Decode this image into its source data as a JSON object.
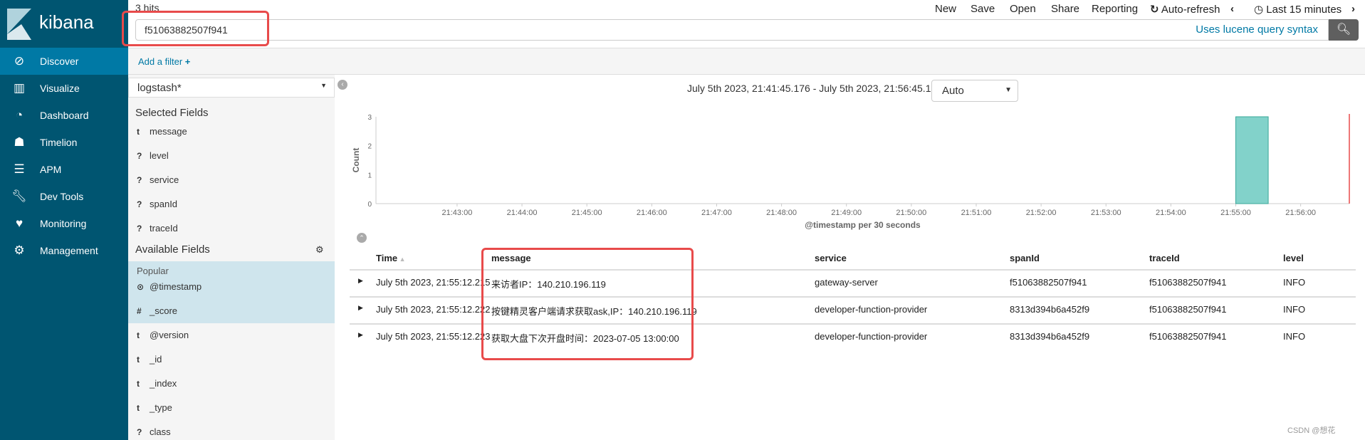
{
  "app": {
    "logo_text": "kibana",
    "hits": "3 hits"
  },
  "sidebar": {
    "items": [
      {
        "label": "Discover",
        "icon": "compass-icon",
        "active": true
      },
      {
        "label": "Visualize",
        "icon": "bar-chart-icon"
      },
      {
        "label": "Dashboard",
        "icon": "dashboard-icon"
      },
      {
        "label": "Timelion",
        "icon": "timelion-icon"
      },
      {
        "label": "APM",
        "icon": "apm-icon"
      },
      {
        "label": "Dev Tools",
        "icon": "wrench-icon"
      },
      {
        "label": "Monitoring",
        "icon": "heartbeat-icon"
      },
      {
        "label": "Management",
        "icon": "gear-icon"
      }
    ]
  },
  "toolbar": {
    "new": "New",
    "save": "Save",
    "open": "Open",
    "share": "Share",
    "reporting": "Reporting",
    "auto_refresh": "Auto-refresh",
    "time": "Last 15 minutes"
  },
  "search": {
    "value": "f51063882507f941",
    "syntax_link": "Uses lucene query syntax"
  },
  "filter": {
    "add": "Add a filter"
  },
  "fields": {
    "index_pattern": "logstash*",
    "selected_title": "Selected Fields",
    "selected": [
      {
        "type": "t",
        "name": "message"
      },
      {
        "type": "?",
        "name": "level"
      },
      {
        "type": "?",
        "name": "service"
      },
      {
        "type": "?",
        "name": "spanId"
      },
      {
        "type": "?",
        "name": "traceId"
      }
    ],
    "available_title": "Available Fields",
    "popular_title": "Popular",
    "available": [
      {
        "type": "⊙",
        "name": "@timestamp"
      },
      {
        "type": "#",
        "name": "_score"
      },
      {
        "type": "t",
        "name": "@version"
      },
      {
        "type": "t",
        "name": "_id"
      },
      {
        "type": "t",
        "name": "_index"
      },
      {
        "type": "t",
        "name": "_type"
      },
      {
        "type": "?",
        "name": "class"
      }
    ]
  },
  "histogram": {
    "range_text": "July 5th 2023, 21:41:45.176 - July 5th 2023, 21:56:45.176 —",
    "interval": "Auto"
  },
  "chart_data": {
    "type": "bar",
    "xlabel": "@timestamp per 30 seconds",
    "ylabel": "Count",
    "ylim": [
      0,
      3
    ],
    "yticks": [
      "0",
      "1",
      "2",
      "3"
    ],
    "xticks": [
      "21:43:00",
      "21:44:00",
      "21:45:00",
      "21:46:00",
      "21:47:00",
      "21:48:00",
      "21:49:00",
      "21:50:00",
      "21:51:00",
      "21:52:00",
      "21:53:00",
      "21:54:00",
      "21:55:00",
      "21:56:00"
    ],
    "xrange": [
      "21:41:45",
      "21:56:45"
    ],
    "bars": [
      {
        "x": "21:55:00",
        "value": 3
      }
    ],
    "bar_color": "#82d2ca",
    "now_line_color": "#e84b4b"
  },
  "table": {
    "headers": [
      "Time",
      "message",
      "service",
      "spanId",
      "traceId",
      "level"
    ],
    "rows": [
      [
        "July 5th 2023, 21:55:12.215",
        "来访者IP：140.210.196.119",
        "gateway-server",
        "f51063882507f941",
        "f51063882507f941",
        "INFO"
      ],
      [
        "July 5th 2023, 21:55:12.222",
        "按键精灵客户端请求获取ask,IP：140.210.196.119",
        "developer-function-provider",
        "8313d394b6a452f9",
        "f51063882507f941",
        "INFO"
      ],
      [
        "July 5th 2023, 21:55:12.223",
        "获取大盘下次开盘时间：2023-07-05 13:00:00",
        "developer-function-provider",
        "8313d394b6a452f9",
        "f51063882507f941",
        "INFO"
      ]
    ]
  },
  "watermark": "CSDN @想花"
}
